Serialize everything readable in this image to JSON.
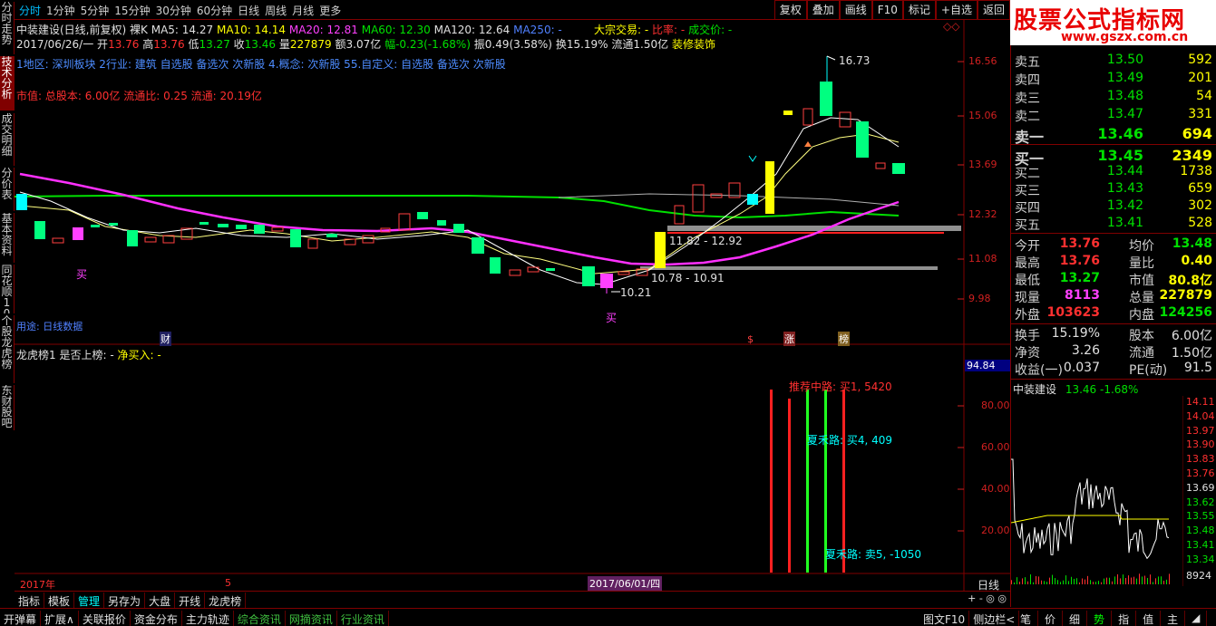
{
  "sidebar": [
    "分时走势",
    "技术分析",
    "成交明细",
    "分价表",
    "基本资料",
    "同花顺10",
    "个股龙虎榜",
    "东财股吧"
  ],
  "periods": [
    "分时",
    "1分钟",
    "5分钟",
    "15分钟",
    "30分钟",
    "60分钟",
    "日线",
    "周线",
    "月线",
    "更多"
  ],
  "tools": [
    "复权",
    "叠加",
    "画线",
    "F10",
    "标记",
    "+自选",
    "返回"
  ],
  "logo": {
    "line1": "股票公式指标网",
    "line2": "www.gszx.com.cn"
  },
  "chart_header": {
    "title": "中装建设(日线,前复权)",
    "mode": "裸K",
    "ma5": "MA5: 14.27",
    "ma10": "MA10: 14.14",
    "ma20": "MA20: 12.81",
    "ma60": "MA60: 12.30",
    "ma120": "MA120: 12.64",
    "ma250": "MA250: -",
    "bigtrade": "大宗交易: -",
    "ratio": "比率: -",
    "deal": "成交价: -",
    "date": "2017/06/26/一",
    "open_l": "开",
    "open": "13.76",
    "high_l": "高",
    "high": "13.76",
    "low_l": "低",
    "low": "13.27",
    "close_l": "收",
    "close": "13.46",
    "vol_l": "量",
    "vol": "227879",
    "amt": "额3.07亿",
    "chg": "幅-0.23(-1.68%)",
    "amp": "振0.49(3.58%)",
    "turn": "换15.19%",
    "float": "流通1.50亿",
    "sector": "装修装饰",
    "regions": "1地区: 深圳板块  2行业: 建筑 自选股 备选次 次新股  4.概念: 次新股  55.自定义: 自选股 备选次 次新股",
    "capital": "市值: 总股本: 6.00亿  流通比: 0.25  流通: 20.19亿"
  },
  "chart_annotations": {
    "high": "16.73",
    "low": "10.21",
    "zone1": "11.82 - 12.92",
    "zone2": "10.78 - 10.91",
    "buy1": "买",
    "buy2": "买",
    "cai": "财",
    "zhang": "涨",
    "bang": "榜",
    "note": "用途: 日线数据"
  },
  "price_axis": [
    "16.56",
    "15.06",
    "13.69",
    "12.32",
    "11.08",
    "9.98"
  ],
  "sub_header": {
    "name": "龙虎榜1",
    "q": "是否上榜: -",
    "net": "净买入: -"
  },
  "sub_axis": {
    "top": "94.84",
    "ticks": [
      "80.00",
      "60.00",
      "40.00",
      "20.00"
    ]
  },
  "sub_labels": {
    "a": "推荐中路: 买1, 5420",
    "b": "夏禾路: 买4, 409",
    "c": "夏禾路: 卖5, -1050"
  },
  "date_bar": {
    "year": "2017年",
    "month": "5",
    "cursor": "2017/06/01/四",
    "period": "日线"
  },
  "quote": {
    "asks": [
      {
        "l": "卖五",
        "p": "13.50",
        "v": "592"
      },
      {
        "l": "卖四",
        "p": "13.49",
        "v": "201"
      },
      {
        "l": "卖三",
        "p": "13.48",
        "v": "54"
      },
      {
        "l": "卖二",
        "p": "13.47",
        "v": "331"
      },
      {
        "l": "卖一",
        "p": "13.46",
        "v": "694"
      }
    ],
    "bids": [
      {
        "l": "买一",
        "p": "13.45",
        "v": "2349"
      },
      {
        "l": "买二",
        "p": "13.44",
        "v": "1738"
      },
      {
        "l": "买三",
        "p": "13.43",
        "v": "659"
      },
      {
        "l": "买四",
        "p": "13.42",
        "v": "302"
      },
      {
        "l": "买五",
        "p": "13.41",
        "v": "528"
      }
    ],
    "stats": [
      {
        "a": "今开",
        "av": "13.76",
        "b": "均价",
        "bv": "13.48"
      },
      {
        "a": "最高",
        "av": "13.76",
        "b": "量比",
        "bv": "0.40"
      },
      {
        "a": "最低",
        "av": "13.27",
        "b": "市值",
        "bv": "80.8亿"
      },
      {
        "a": "现量",
        "av": "8113",
        "b": "总量",
        "bv": "227879"
      },
      {
        "a": "外盘",
        "av": "103623",
        "b": "内盘",
        "bv": "124256"
      }
    ],
    "fin": [
      {
        "a": "换手",
        "av": "15.19%",
        "b": "股本",
        "bv": "6.00亿"
      },
      {
        "a": "净资",
        "av": "3.26",
        "b": "流通",
        "bv": "1.50亿"
      },
      {
        "a": "收益(一)",
        "av": "0.037",
        "b": "PE(动)",
        "bv": "91.5"
      }
    ]
  },
  "mini": {
    "name": "中装建设",
    "price": "13.46",
    "chg": "-1.68%",
    "axis": [
      "14.11",
      "14.04",
      "13.97",
      "13.90",
      "13.83",
      "13.76",
      "13.69",
      "13.62",
      "13.55",
      "13.48",
      "13.41",
      "13.34"
    ],
    "vol": "8924"
  },
  "bottom_tabs1": [
    "指标",
    "模板",
    "管理",
    "另存为",
    "大盘",
    "开线",
    "龙虎榜"
  ],
  "bottom_tabs2": [
    "开弹幕",
    "扩展∧",
    "关联报价",
    "资金分布",
    "主力轨迹",
    "综合资讯",
    "网摘资讯",
    "行业资讯"
  ],
  "status_right": [
    "图文F10",
    "侧边栏<"
  ],
  "status_icons": [
    "笔",
    "价",
    "细",
    "势",
    "指",
    "值",
    "主",
    "◢"
  ]
}
